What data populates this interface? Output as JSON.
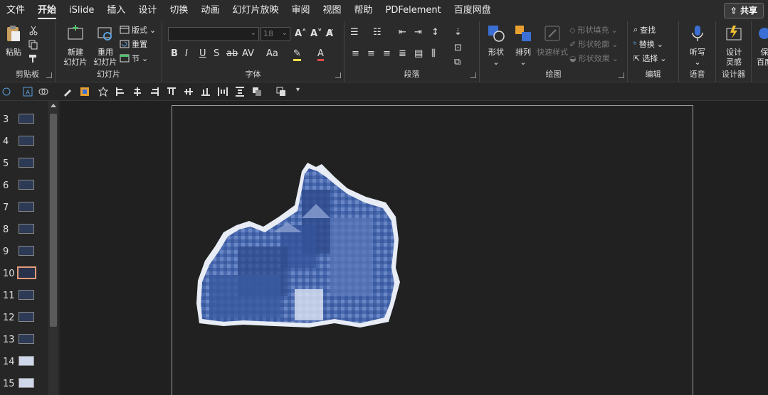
{
  "menu": {
    "tabs": [
      "文件",
      "开始",
      "iSlide",
      "插入",
      "设计",
      "切换",
      "动画",
      "幻灯片放映",
      "审阅",
      "视图",
      "帮助",
      "PDFelement",
      "百度网盘"
    ],
    "active_tab": "开始",
    "share_label": "共享"
  },
  "ribbon": {
    "clipboard": {
      "paste_label": "粘贴",
      "group_label": "剪贴板"
    },
    "slides": {
      "new_slide_label": "新建\n幻灯片",
      "reuse_slide_label": "重用\n幻灯片",
      "layout_label": "版式",
      "reset_label": "重置",
      "section_label": "节",
      "group_label": "幻灯片"
    },
    "font": {
      "font_name": "",
      "font_size": "18",
      "group_label": "字体"
    },
    "paragraph": {
      "group_label": "段落"
    },
    "drawing": {
      "shapes_label": "形状",
      "arrange_label": "排列",
      "quick_styles_label": "快速样式",
      "shape_fill_label": "形状填充",
      "shape_outline_label": "形状轮廓",
      "shape_effects_label": "形状效果",
      "group_label": "绘图"
    },
    "editing": {
      "find_label": "查找",
      "replace_label": "替换",
      "select_label": "选择",
      "group_label": "编辑"
    },
    "voice": {
      "dictate_label": "听写",
      "group_label": "语音"
    },
    "designer": {
      "design_ideas_label": "设计\n灵感",
      "group_label": "设计器"
    },
    "save": {
      "label_line1": "保",
      "label_line2": "百度"
    }
  },
  "thumbnails": {
    "numbers": [
      "3",
      "4",
      "5",
      "6",
      "7",
      "8",
      "9",
      "10",
      "11",
      "12",
      "13",
      "14",
      "15"
    ],
    "selected": "10"
  },
  "colors": {
    "accent": "#3b6fd4",
    "selection": "#e39a7a",
    "image_tint": "#3d5fa8"
  }
}
